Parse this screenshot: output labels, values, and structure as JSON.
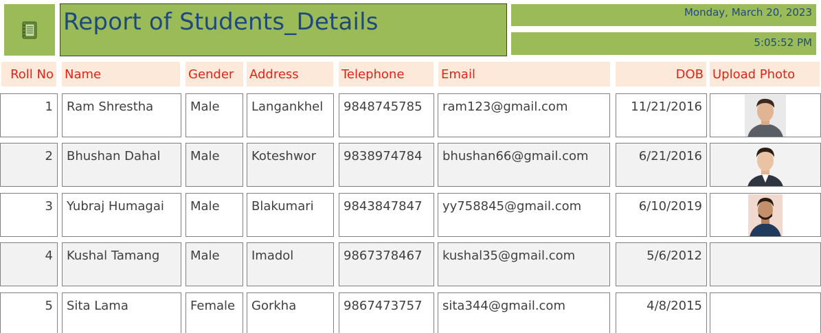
{
  "report": {
    "title": "Report of Students_Details",
    "date": "Monday, March 20, 2023",
    "time": "5:05:52 PM"
  },
  "columns": [
    {
      "key": "roll_no",
      "label": "Roll No"
    },
    {
      "key": "name",
      "label": "Name"
    },
    {
      "key": "gender",
      "label": "Gender"
    },
    {
      "key": "address",
      "label": "Address"
    },
    {
      "key": "telephone",
      "label": "Telephone"
    },
    {
      "key": "email",
      "label": "Email"
    },
    {
      "key": "dob",
      "label": "DOB"
    },
    {
      "key": "photo",
      "label": "Upload Photo"
    }
  ],
  "rows": [
    {
      "roll_no": "1",
      "name": "Ram Shrestha",
      "gender": "Male",
      "address": "Langankhel",
      "telephone": "9848745785",
      "email": "ram123@gmail.com",
      "dob": "11/21/2016",
      "photo": "portrait-photo"
    },
    {
      "roll_no": "2",
      "name": "Bhushan Dahal",
      "gender": "Male",
      "address": "Koteshwor",
      "telephone": "9838974784",
      "email": "bhushan66@gmail.com",
      "dob": "6/21/2016",
      "photo": "portrait-photo"
    },
    {
      "roll_no": "3",
      "name": "Yubraj Humagai",
      "gender": "Male",
      "address": "Blakumari",
      "telephone": "9843847847",
      "email": "yy758845@gmail.com",
      "dob": "6/10/2019",
      "photo": "portrait-photo"
    },
    {
      "roll_no": "4",
      "name": "Kushal Tamang",
      "gender": "Male",
      "address": "Imadol",
      "telephone": "9867378467",
      "email": "kushal35@gmail.com",
      "dob": "5/6/2012",
      "photo": ""
    },
    {
      "roll_no": "5",
      "name": "Sita Lama",
      "gender": "Female",
      "address": "Gorkha",
      "telephone": "9867473757",
      "email": "sita344@gmail.com",
      "dob": "4/8/2015",
      "photo": ""
    }
  ],
  "colors": {
    "header_band": "#9bbb59",
    "title_text": "#1f497d",
    "column_header_bg": "#fde9d9",
    "column_header_text": "#e2231a",
    "alt_row_bg": "#f2f2f2"
  },
  "icons": {
    "report": "report-icon"
  }
}
